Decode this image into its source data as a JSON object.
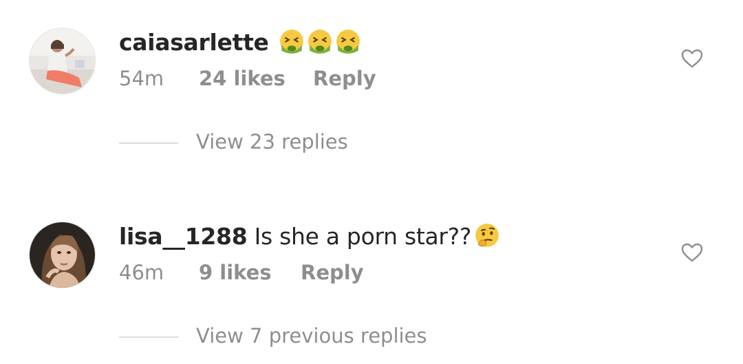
{
  "comments": [
    {
      "username": "caiasarlette",
      "text": "",
      "emojis": [
        "nauseated-face",
        "nauseated-face",
        "nauseated-face"
      ],
      "time": "54m",
      "likes": "24 likes",
      "reply_label": "Reply",
      "view_replies": "View 23 replies"
    },
    {
      "username": "lisa__1288",
      "text": "Is she a porn star??",
      "emojis": [
        "thinking-face"
      ],
      "time": "46m",
      "likes": "9 likes",
      "reply_label": "Reply",
      "view_replies": "View 7 previous replies"
    }
  ],
  "colors": {
    "primary_text": "#262626",
    "secondary_text": "#8e8e8e",
    "divider": "#dbdbdb",
    "heart_outline": "#8e8e8e"
  }
}
